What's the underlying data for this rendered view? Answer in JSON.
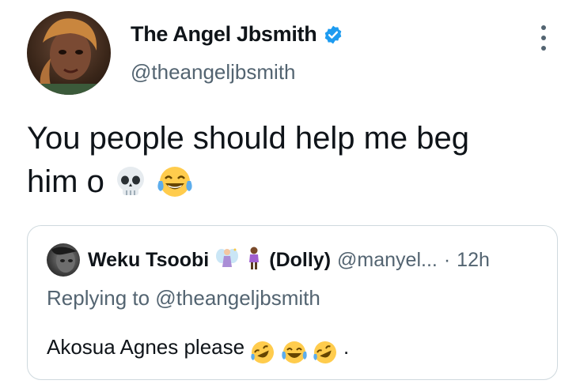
{
  "tweet": {
    "display_name": "The Angel Jbsmith",
    "handle": "@theangeljbsmith",
    "text_line1": "You people should help me beg",
    "text_line2": "him o",
    "emojis": [
      "skull-emoji",
      "tears-of-joy-emoji"
    ]
  },
  "quote": {
    "display_name": "Weku Tsoobi",
    "display_name_suffix": "(Dolly)",
    "handle": "@manyel...",
    "separator": "·",
    "time": "12h",
    "replying_to": "Replying to @theangeljbsmith",
    "text": "Akosua Agnes please",
    "text_end": "."
  },
  "colors": {
    "text": "#0f1419",
    "secondary": "#536471",
    "verified": "#1d9bf0",
    "border": "#cfd9de"
  }
}
